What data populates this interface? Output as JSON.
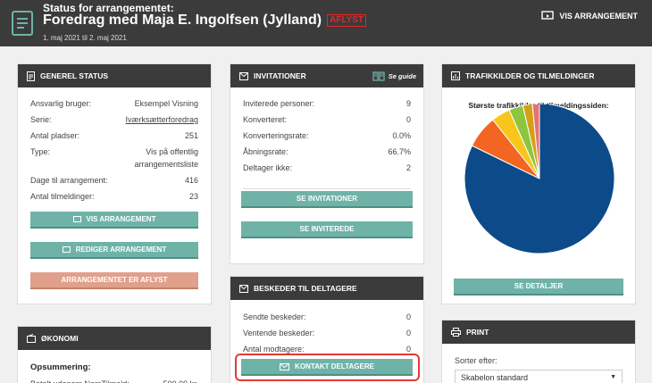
{
  "header": {
    "supertitle": "Status for arrangementet:",
    "title": "Foredrag med Maja E. Ingolfsen (Jylland)",
    "badge": "AFLYST",
    "dates": "1. maj 2021 til 2. maj 2021",
    "vis_button": "VIS ARRANGEMENT"
  },
  "general": {
    "heading": "GENEREL STATUS",
    "rows": [
      {
        "label": "Ansvarlig bruger:",
        "value": "Eksempel Visning"
      },
      {
        "label": "Serie:",
        "value": "Iværksætterforedrag"
      },
      {
        "label": "Antal pladser:",
        "value": "251"
      },
      {
        "label": "Type:",
        "value": "Vis på offentlig arrangementsliste"
      },
      {
        "label": "Dage til arrangement:",
        "value": "416"
      },
      {
        "label": "Antal tilmeldinger:",
        "value": "23"
      }
    ],
    "buttons": {
      "vis": "VIS ARRANGEMENT",
      "rediger": "REDIGER ARRANGEMENT",
      "aflyst": "ARRANGEMENTET ER AFLYST"
    }
  },
  "economy": {
    "heading": "ØKONOMI",
    "summary": "Opsummering:",
    "partial_row": "Betalt udenom NemTilmeld:",
    "partial_value": "500,00 kr."
  },
  "invitations": {
    "heading": "INVITATIONER",
    "guide": "Se guide",
    "rows": [
      {
        "label": "Inviterede personer:",
        "value": "9"
      },
      {
        "label": "Konverteret:",
        "value": "0"
      },
      {
        "label": "Konverteringsrate:",
        "value": "0.0%"
      },
      {
        "label": "Åbningsrate:",
        "value": "66.7%"
      },
      {
        "label": "Deltager ikke:",
        "value": "2"
      }
    ],
    "buttons": {
      "invitationer": "SE INVITATIONER",
      "inviterede": "SE INVITEREDE"
    }
  },
  "messages": {
    "heading": "BESKEDER TIL DELTAGERE",
    "rows": [
      {
        "label": "Sendte beskeder:",
        "value": "0"
      },
      {
        "label": "Ventende beskeder:",
        "value": "0"
      },
      {
        "label": "Antal modtagere:",
        "value": "0"
      }
    ],
    "button": "KONTAKT DELTAGERE"
  },
  "traffic": {
    "heading": "TRAFIKKILDER OG TILMELDINGER",
    "subtitle": "Største trafikkilder til tilmeldingssiden:",
    "button": "SE DETALJER"
  },
  "chart_data": {
    "type": "pie",
    "title": "Største trafikkilder til tilmeldingssiden:",
    "values": [
      81,
      7,
      4,
      3,
      2,
      1.5
    ],
    "colors": [
      "#0c4a8a",
      "#f26522",
      "#f7c61a",
      "#8cc63f",
      "#d4a017",
      "#e57373"
    ]
  },
  "print": {
    "heading": "PRINT",
    "sort_label": "Sorter efter:",
    "sort_value": "Skabelon standard"
  }
}
